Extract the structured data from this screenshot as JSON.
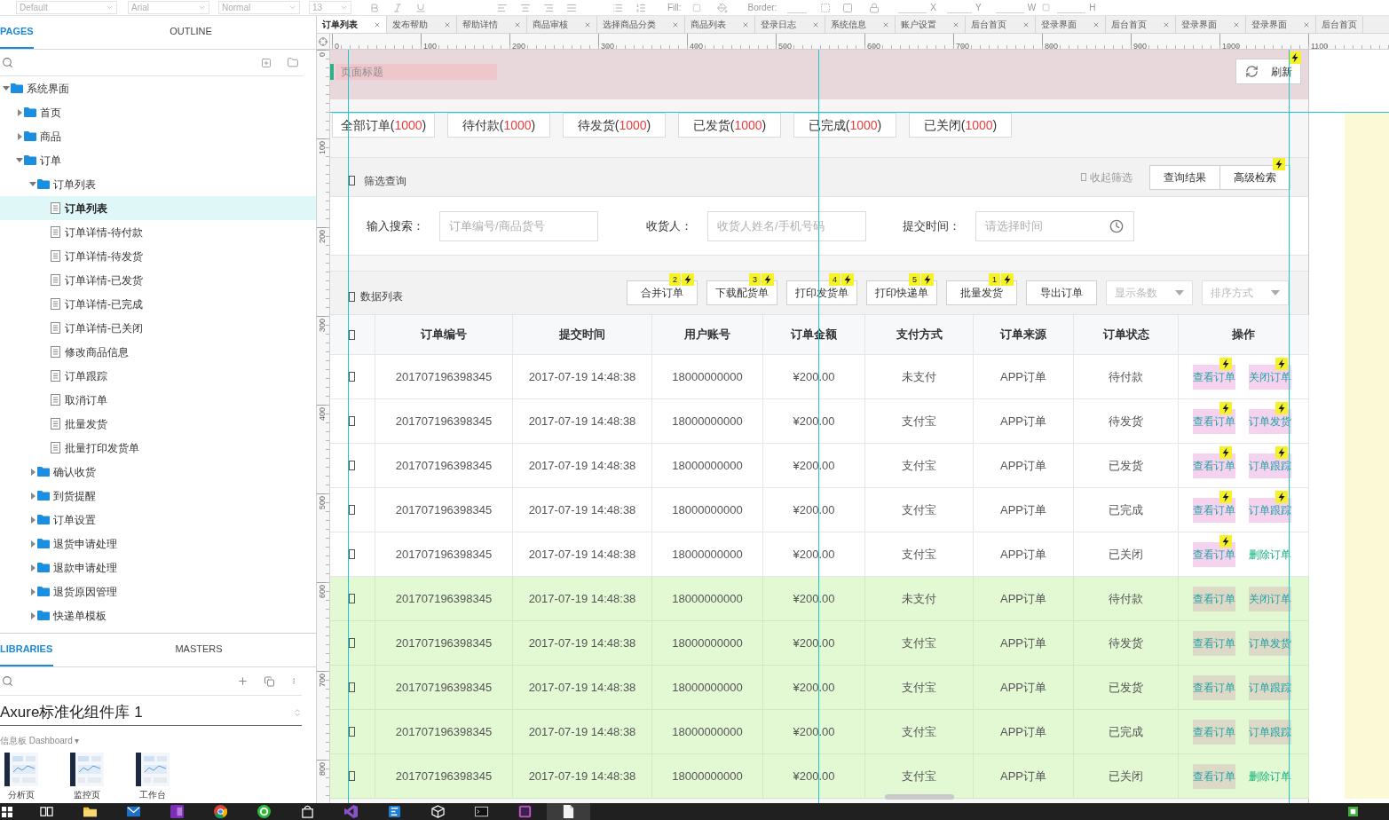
{
  "toolbar": {
    "style": "Default",
    "font": "Arial",
    "weight": "Normal",
    "size": "13",
    "fill_label": "Fill:",
    "border_label": "Border:",
    "x_label": "X",
    "y_label": "Y",
    "w_label": "W",
    "h_label": "H"
  },
  "pages_panel": {
    "tabs": [
      {
        "label": "PAGES",
        "selected": true
      },
      {
        "label": "OUTLINE",
        "selected": false
      }
    ],
    "tree": [
      {
        "label": "系统界面",
        "kind": "folder",
        "expanded": true,
        "selected": false,
        "children": [
          {
            "label": "首页",
            "kind": "folder",
            "expanded": false,
            "selected": false
          },
          {
            "label": "商品",
            "kind": "folder",
            "expanded": false,
            "selected": false
          },
          {
            "label": "订单",
            "kind": "folder",
            "expanded": true,
            "selected": false,
            "children": [
              {
                "label": "订单列表",
                "kind": "folder",
                "expanded": true,
                "selected": false,
                "children": [
                  {
                    "label": "订单列表",
                    "kind": "page",
                    "selected": true
                  },
                  {
                    "label": "订单详情-待付款",
                    "kind": "page",
                    "selected": false
                  },
                  {
                    "label": "订单详情-待发货",
                    "kind": "page",
                    "selected": false
                  },
                  {
                    "label": "订单详情-已发货",
                    "kind": "page",
                    "selected": false
                  },
                  {
                    "label": "订单详情-已完成",
                    "kind": "page",
                    "selected": false
                  },
                  {
                    "label": "订单详情-已关闭",
                    "kind": "page",
                    "selected": false
                  },
                  {
                    "label": "修改商品信息",
                    "kind": "page",
                    "selected": false
                  },
                  {
                    "label": "订单跟踪",
                    "kind": "page",
                    "selected": false
                  },
                  {
                    "label": "取消订单",
                    "kind": "page",
                    "selected": false
                  },
                  {
                    "label": "批量发货",
                    "kind": "page",
                    "selected": false
                  },
                  {
                    "label": "批量打印发货单",
                    "kind": "page",
                    "selected": false
                  }
                ]
              },
              {
                "label": "确认收货",
                "kind": "folder",
                "expanded": false,
                "selected": false
              },
              {
                "label": "到货提醒",
                "kind": "folder",
                "expanded": false,
                "selected": false
              },
              {
                "label": "订单设置",
                "kind": "folder",
                "expanded": false,
                "selected": false
              },
              {
                "label": "退货申请处理",
                "kind": "folder",
                "expanded": false,
                "selected": false
              },
              {
                "label": "退款申请处理",
                "kind": "folder",
                "expanded": false,
                "selected": false
              },
              {
                "label": "退货原因管理",
                "kind": "folder",
                "expanded": false,
                "selected": false
              },
              {
                "label": "快递单模板",
                "kind": "folder",
                "expanded": false,
                "selected": false
              }
            ]
          }
        ]
      }
    ]
  },
  "libraries_panel": {
    "tabs": [
      {
        "label": "LIBRARIES",
        "selected": true
      },
      {
        "label": "MASTERS",
        "selected": false
      }
    ],
    "library": "Axure标准化组件库 1",
    "category": "信息板 Dashboard ▾",
    "items": [
      {
        "label": "分析页"
      },
      {
        "label": "监控页"
      },
      {
        "label": "工作台"
      }
    ]
  },
  "document_tabs": [
    {
      "label": "订单列表",
      "selected": true,
      "closable": true
    },
    {
      "label": "发布帮助",
      "selected": false,
      "closable": true
    },
    {
      "label": "帮助详情",
      "selected": false,
      "closable": true
    },
    {
      "label": "商品审核",
      "selected": false,
      "closable": true
    },
    {
      "label": "选择商品分类",
      "selected": false,
      "closable": true
    },
    {
      "label": "商品列表",
      "selected": false,
      "closable": true
    },
    {
      "label": "登录日志",
      "selected": false,
      "closable": true
    },
    {
      "label": "系统信息",
      "selected": false,
      "closable": true
    },
    {
      "label": "账户设置",
      "selected": false,
      "closable": true
    },
    {
      "label": "后台首页",
      "selected": false,
      "closable": true
    },
    {
      "label": "登录界面",
      "selected": false,
      "closable": true
    },
    {
      "label": "后台首页",
      "selected": false,
      "closable": true
    },
    {
      "label": "登录界面",
      "selected": false,
      "closable": true
    },
    {
      "label": "登录界面",
      "selected": false,
      "closable": true
    },
    {
      "label": "后台首页",
      "selected": false,
      "closable": false
    }
  ],
  "rulers": {
    "horizontal": [
      "0",
      "100",
      "200",
      "300",
      "400",
      "500",
      "600",
      "700",
      "800",
      "900",
      "1000",
      "1100"
    ],
    "vertical": [
      "0",
      "100",
      "200",
      "300",
      "400",
      "500",
      "600",
      "700",
      "800"
    ]
  },
  "page": {
    "header": {
      "title": "页面标题",
      "refresh": {
        "label": "刷新",
        "interaction": true
      }
    },
    "status_tabs": [
      {
        "label": "全部订单(",
        "count": "1000",
        "suffix": ")"
      },
      {
        "label": "待付款(",
        "count": "1000",
        "suffix": ")"
      },
      {
        "label": "待发货(",
        "count": "1000",
        "suffix": ")"
      },
      {
        "label": "已发货(",
        "count": "1000",
        "suffix": ")"
      },
      {
        "label": "已完成(",
        "count": "1000",
        "suffix": ")"
      },
      {
        "label": "已关闭(",
        "count": "1000",
        "suffix": ")"
      }
    ],
    "filter": {
      "title": "筛选查询",
      "collapse": "收起筛选",
      "buttons": [
        {
          "label": "查询结果",
          "interaction": false
        },
        {
          "label": "高级检索",
          "interaction": true
        }
      ],
      "fields": [
        {
          "label": "输入搜索：",
          "placeholder": "订单编号/商品货号",
          "kind": "text"
        },
        {
          "label": "收货人：",
          "placeholder": "收货人姓名/手机号码",
          "kind": "text"
        },
        {
          "label": "提交时间：",
          "placeholder": "请选择时间",
          "kind": "time"
        }
      ]
    },
    "list": {
      "title": "数据列表",
      "actions": [
        {
          "label": "合并订单",
          "step": "2",
          "interaction": true
        },
        {
          "label": "下载配货单",
          "step": "3",
          "interaction": true
        },
        {
          "label": "打印发货单",
          "step": "4",
          "interaction": true
        },
        {
          "label": "打印快递单",
          "step": "5",
          "interaction": true
        },
        {
          "label": "批量发货",
          "step": "1",
          "interaction": true
        },
        {
          "label": "导出订单",
          "interaction": false
        }
      ],
      "selects": [
        {
          "placeholder": "显示条数"
        },
        {
          "placeholder": "排序方式"
        }
      ]
    },
    "table": {
      "header_checked": false,
      "columns": [
        "订单编号",
        "提交时间",
        "用户账号",
        "订单金额",
        "支付方式",
        "订单来源",
        "订单状态",
        "操作"
      ],
      "rows": [
        {
          "checked": false,
          "highlighted": false,
          "cells": [
            "201707196398345",
            "2017-07-19 14:48:38",
            "18000000000",
            "¥200.00",
            "未支付",
            "APP订单",
            "待付款"
          ],
          "actions": [
            {
              "label": "查看订单",
              "kind": "marked",
              "interaction": true
            },
            {
              "label": "关闭订单",
              "kind": "marked",
              "interaction": true
            }
          ]
        },
        {
          "checked": false,
          "highlighted": false,
          "cells": [
            "201707196398345",
            "2017-07-19 14:48:38",
            "18000000000",
            "¥200.00",
            "支付宝",
            "APP订单",
            "待发货"
          ],
          "actions": [
            {
              "label": "查看订单",
              "kind": "marked",
              "interaction": true
            },
            {
              "label": "订单发货",
              "kind": "marked",
              "interaction": true
            }
          ]
        },
        {
          "checked": false,
          "highlighted": false,
          "cells": [
            "201707196398345",
            "2017-07-19 14:48:38",
            "18000000000",
            "¥200.00",
            "支付宝",
            "APP订单",
            "已发货"
          ],
          "actions": [
            {
              "label": "查看订单",
              "kind": "marked",
              "interaction": true
            },
            {
              "label": "订单跟踪",
              "kind": "marked",
              "interaction": true
            }
          ]
        },
        {
          "checked": false,
          "highlighted": false,
          "cells": [
            "201707196398345",
            "2017-07-19 14:48:38",
            "18000000000",
            "¥200.00",
            "支付宝",
            "APP订单",
            "已完成"
          ],
          "actions": [
            {
              "label": "查看订单",
              "kind": "marked",
              "interaction": true
            },
            {
              "label": "订单跟踪",
              "kind": "marked",
              "interaction": true
            }
          ]
        },
        {
          "checked": false,
          "highlighted": false,
          "cells": [
            "201707196398345",
            "2017-07-19 14:48:38",
            "18000000000",
            "¥200.00",
            "支付宝",
            "APP订单",
            "已关闭"
          ],
          "actions": [
            {
              "label": "查看订单",
              "kind": "marked",
              "interaction": true
            },
            {
              "label": "删除订单",
              "kind": "plain",
              "interaction": false
            }
          ]
        },
        {
          "checked": false,
          "highlighted": true,
          "cells": [
            "201707196398345",
            "2017-07-19 14:48:38",
            "18000000000",
            "¥200.00",
            "未支付",
            "APP订单",
            "待付款"
          ],
          "actions": [
            {
              "label": "查看订单",
              "kind": "marked",
              "interaction": false
            },
            {
              "label": "关闭订单",
              "kind": "marked",
              "interaction": false
            }
          ]
        },
        {
          "checked": false,
          "highlighted": true,
          "cells": [
            "201707196398345",
            "2017-07-19 14:48:38",
            "18000000000",
            "¥200.00",
            "支付宝",
            "APP订单",
            "待发货"
          ],
          "actions": [
            {
              "label": "查看订单",
              "kind": "marked",
              "interaction": false
            },
            {
              "label": "订单发货",
              "kind": "marked",
              "interaction": false
            }
          ]
        },
        {
          "checked": false,
          "highlighted": true,
          "cells": [
            "201707196398345",
            "2017-07-19 14:48:38",
            "18000000000",
            "¥200.00",
            "支付宝",
            "APP订单",
            "已发货"
          ],
          "actions": [
            {
              "label": "查看订单",
              "kind": "marked",
              "interaction": false
            },
            {
              "label": "订单跟踪",
              "kind": "marked",
              "interaction": false
            }
          ]
        },
        {
          "checked": false,
          "highlighted": true,
          "cells": [
            "201707196398345",
            "2017-07-19 14:48:38",
            "18000000000",
            "¥200.00",
            "支付宝",
            "APP订单",
            "已完成"
          ],
          "actions": [
            {
              "label": "查看订单",
              "kind": "marked",
              "interaction": false
            },
            {
              "label": "订单跟踪",
              "kind": "marked",
              "interaction": false
            }
          ]
        },
        {
          "checked": false,
          "highlighted": true,
          "cells": [
            "201707196398345",
            "2017-07-19 14:48:38",
            "18000000000",
            "¥200.00",
            "支付宝",
            "APP订单",
            "已关闭"
          ],
          "actions": [
            {
              "label": "查看订单",
              "kind": "marked",
              "interaction": false
            },
            {
              "label": "删除订单",
              "kind": "plain",
              "interaction": false
            }
          ]
        }
      ]
    }
  }
}
